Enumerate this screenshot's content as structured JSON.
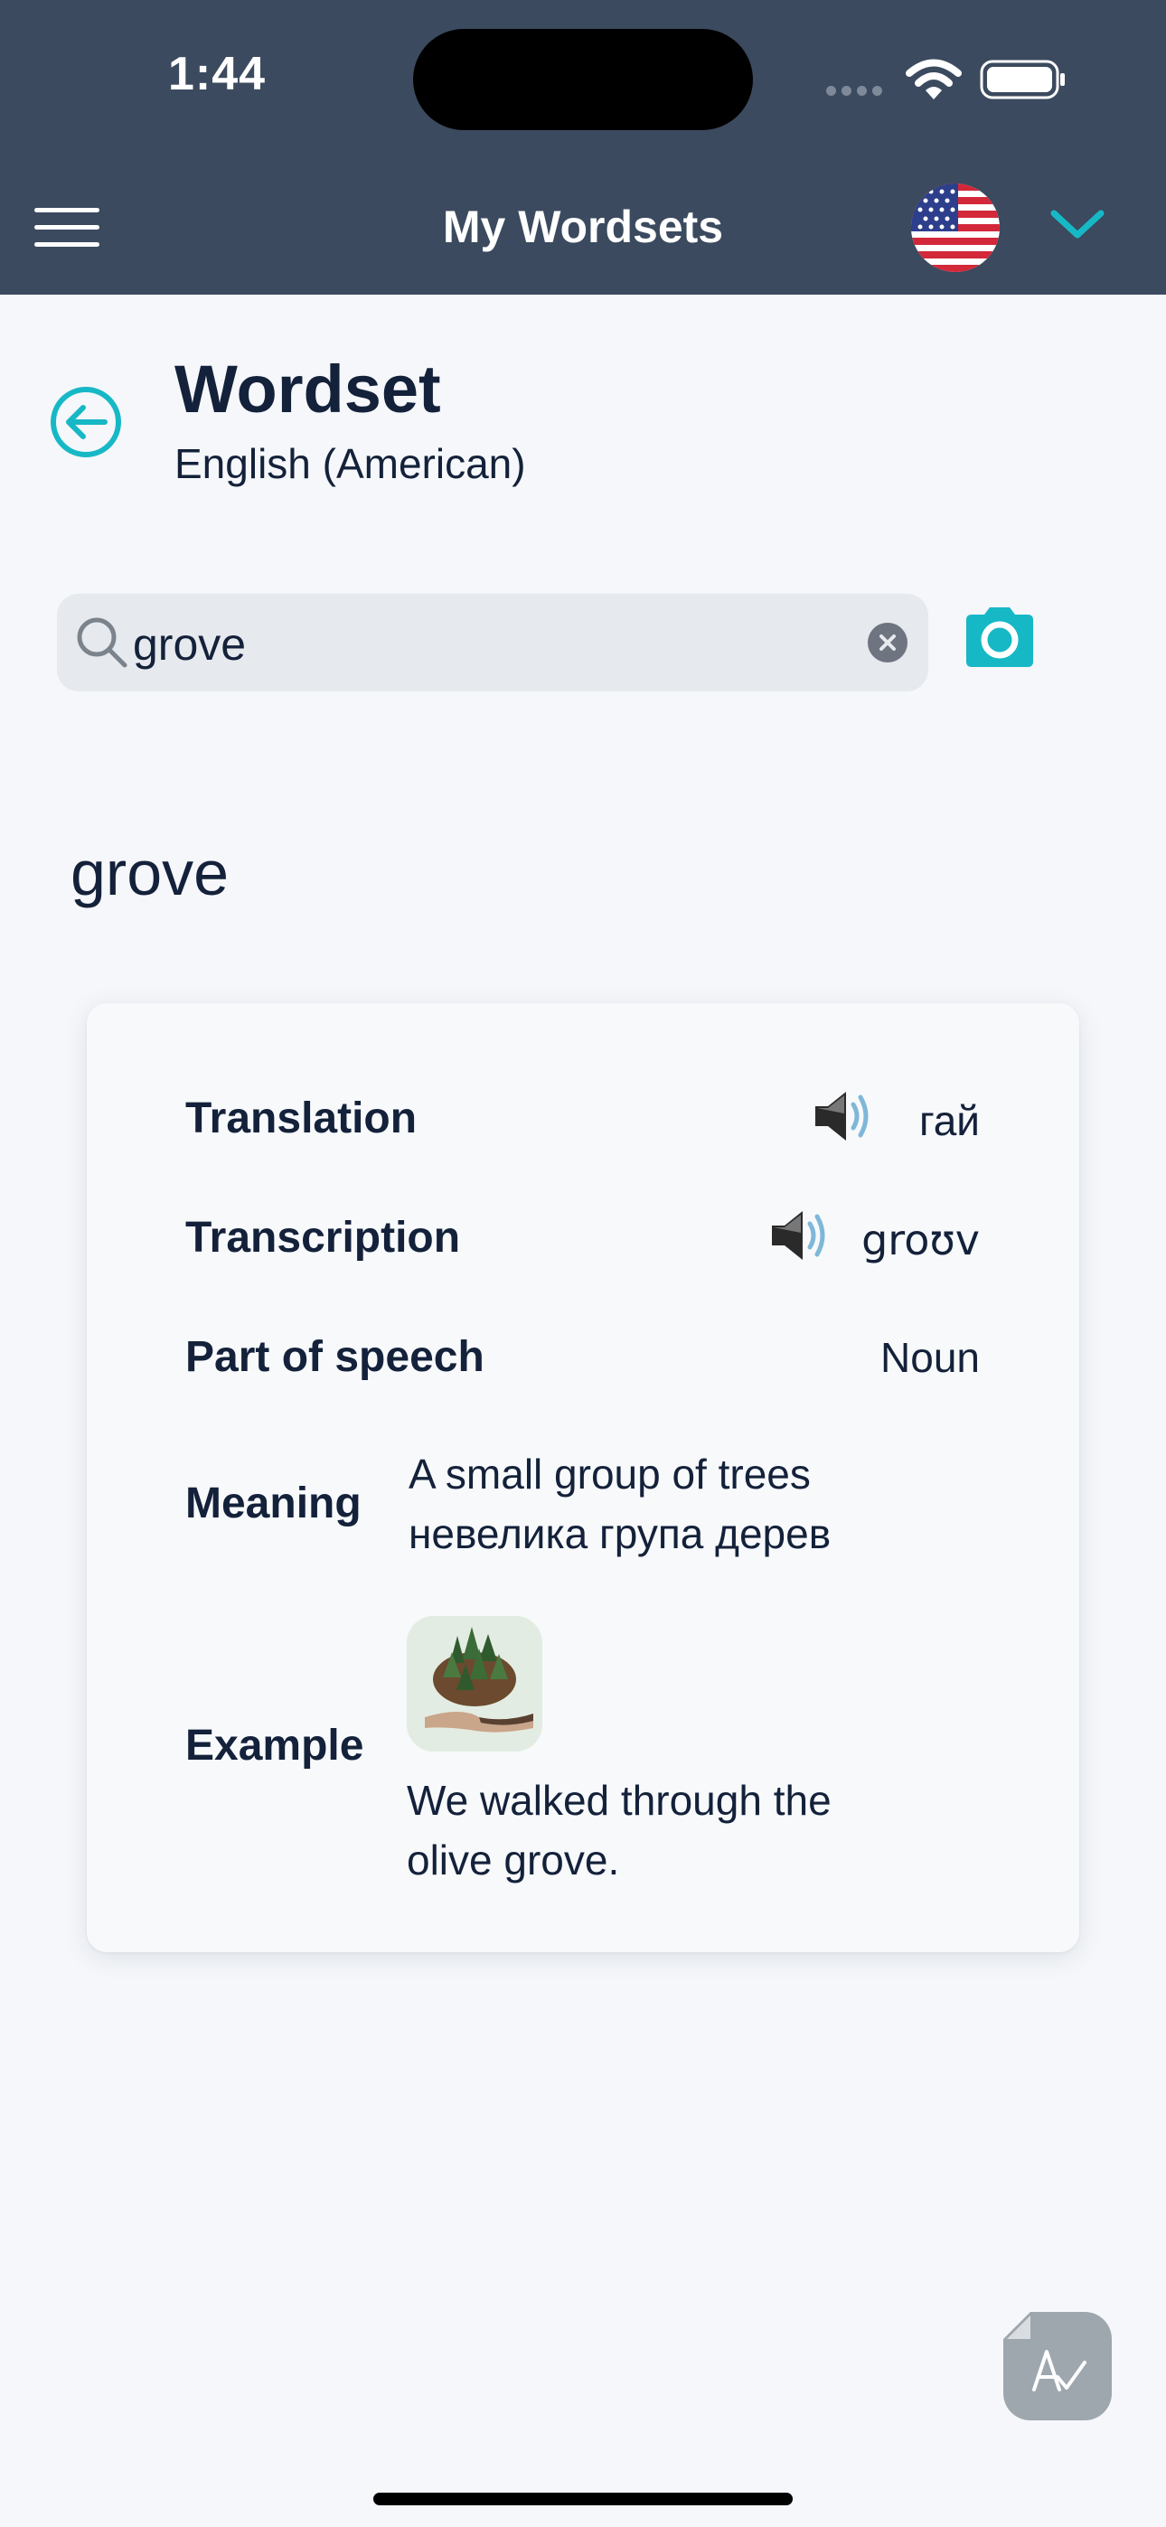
{
  "status_bar": {
    "time": "1:44"
  },
  "header": {
    "title": "My Wordsets",
    "flag_icon": "us-flag-icon"
  },
  "wordset": {
    "title": "Wordset",
    "language": "English (American)"
  },
  "search": {
    "value": "grove"
  },
  "word": "grove",
  "details": {
    "translation_label": "Translation",
    "translation_value": "гай",
    "transcription_label": "Transcription",
    "transcription_value": "groʊv",
    "pos_label": "Part of speech",
    "pos_value": "Noun",
    "meaning_label": "Meaning",
    "meaning_en": "A small group of trees",
    "meaning_uk": "невелика група дерев",
    "example_label": "Example",
    "example_line1": "We walked through the",
    "example_line2": "olive grove."
  },
  "colors": {
    "header_bg": "#3b4a5e",
    "accent": "#17b8c6",
    "page_bg": "#f5f7fa",
    "text": "#14213a"
  }
}
